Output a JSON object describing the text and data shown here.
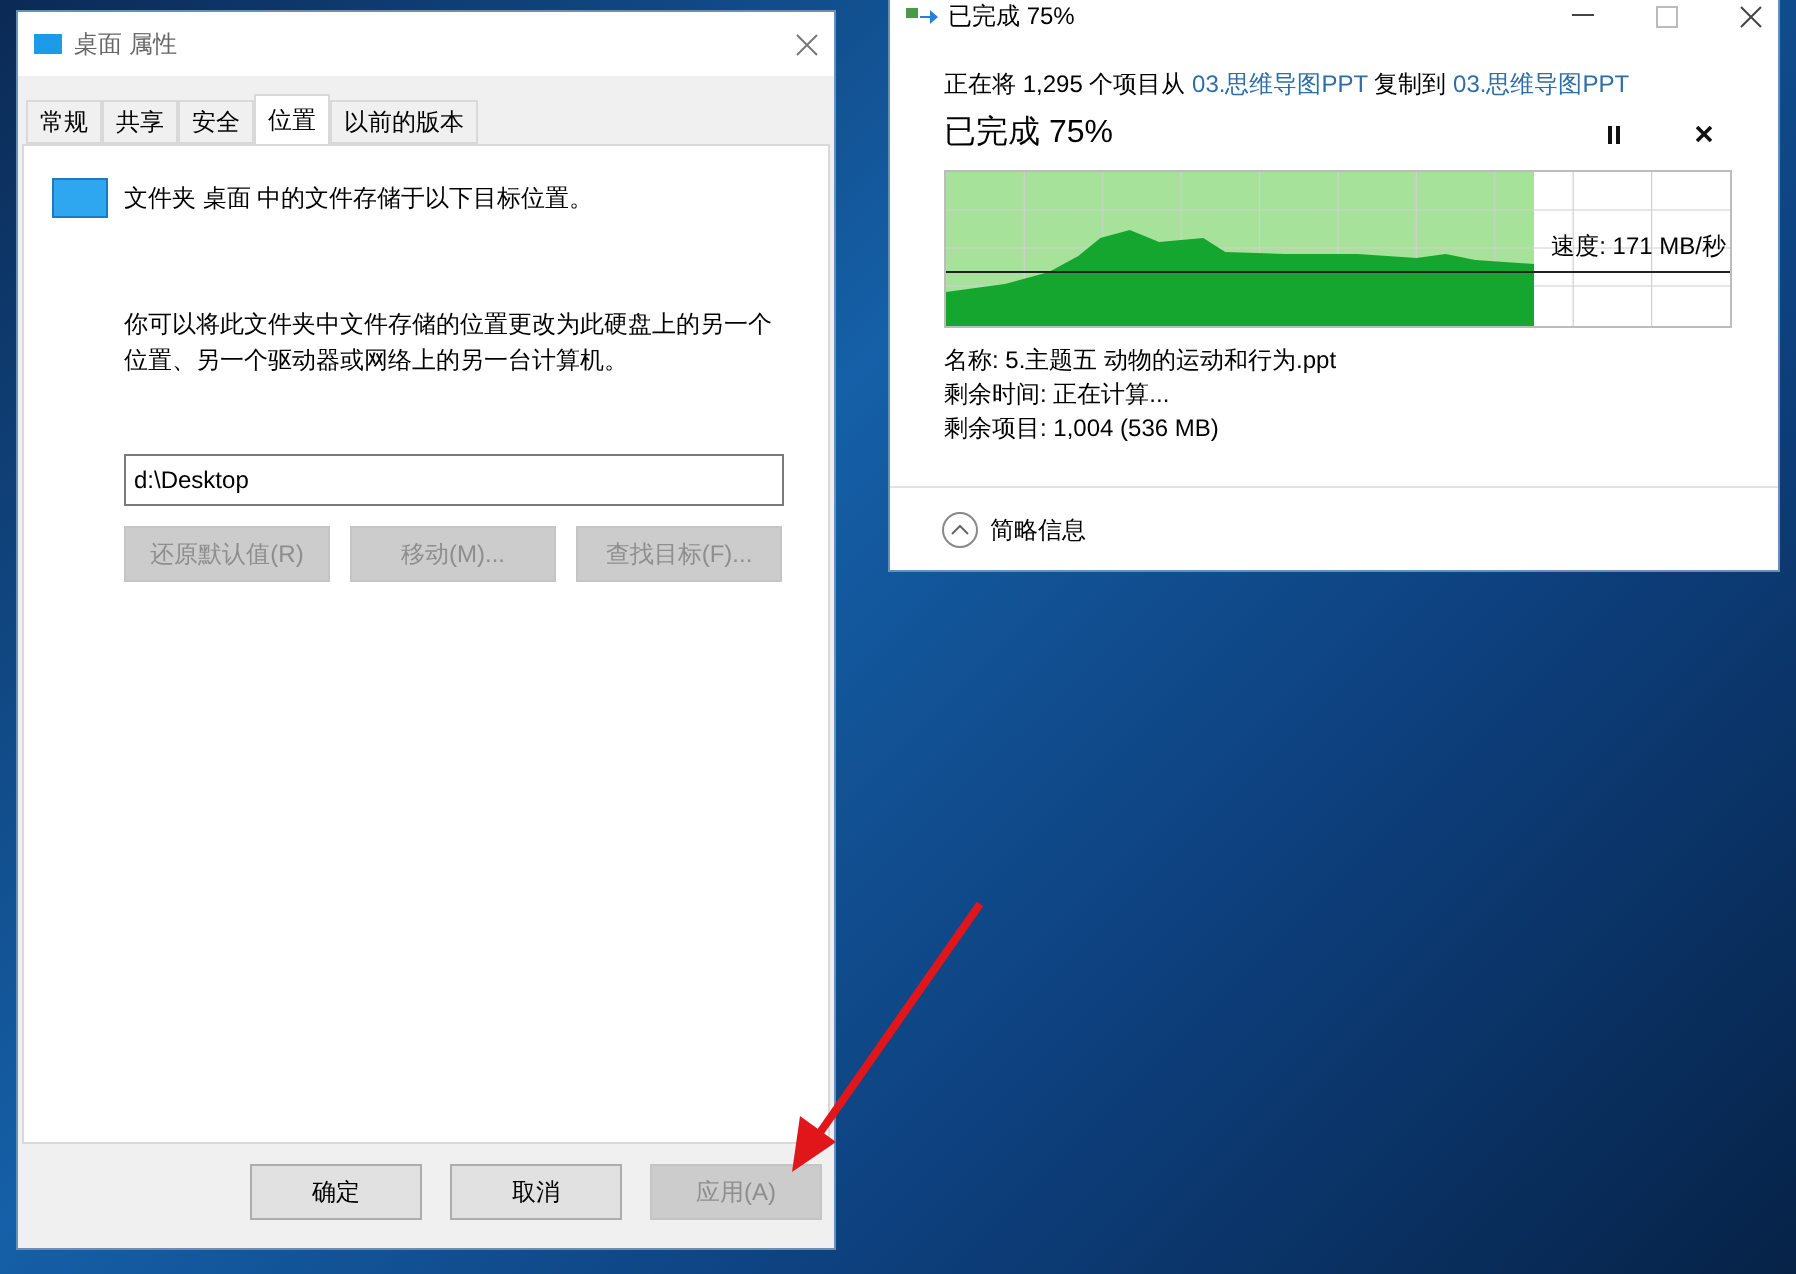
{
  "properties_window": {
    "title": "桌面 属性",
    "tabs": [
      {
        "label": "常规",
        "selected": false
      },
      {
        "label": "共享",
        "selected": false
      },
      {
        "label": "安全",
        "selected": false
      },
      {
        "label": "位置",
        "selected": true
      },
      {
        "label": "以前的版本",
        "selected": false
      }
    ],
    "heading": "文件夹 桌面 中的文件存储于以下目标位置。",
    "description": "你可以将此文件夹中文件存储的位置更改为此硬盘上的另一个位置、另一个驱动器或网络上的另一台计算机。",
    "path_field": {
      "value": "d:\\Desktop"
    },
    "location_buttons": [
      {
        "label": "还原默认值(R)",
        "disabled": true
      },
      {
        "label": "移动(M)...",
        "disabled": true
      },
      {
        "label": "查找目标(F)...",
        "disabled": true
      }
    ],
    "footer_buttons": [
      {
        "label": "确定",
        "disabled": false
      },
      {
        "label": "取消",
        "disabled": false
      },
      {
        "label": "应用(A)",
        "disabled": true
      }
    ]
  },
  "copy_window": {
    "title": "已完成 75%",
    "summary": {
      "prefix": "正在将 1,295 个项目从 ",
      "source": "03.思维导图PPT",
      "middle": " 复制到 ",
      "destination": "03.思维导图PPT"
    },
    "status": "已完成 75%",
    "progress": {
      "level": 0.75,
      "speed": "速度: 171 MB/秒"
    },
    "details": [
      "名称: 5.主题五 动物的运动和行为.ppt",
      "剩余时间: 正在计算...",
      "剩余项目: 1,004 (536 MB)"
    ],
    "toggle": {
      "label": "简略信息",
      "expanded": true
    }
  }
}
